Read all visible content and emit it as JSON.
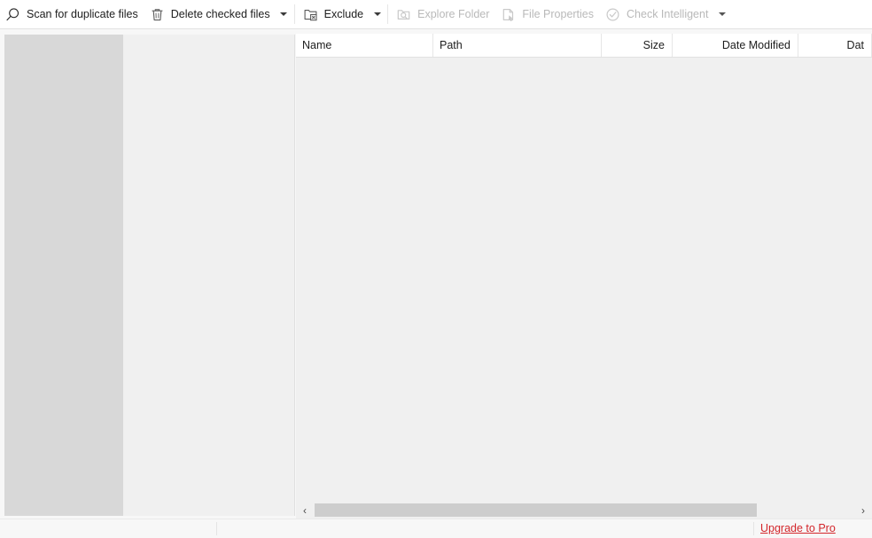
{
  "toolbar": {
    "items": [
      {
        "id": "scan",
        "label": "Scan for duplicate files",
        "icon": "magnifier-icon",
        "enabled": true,
        "caret": false
      },
      {
        "id": "delete",
        "label": "Delete checked files",
        "icon": "trash-icon",
        "enabled": true,
        "caret": true
      },
      {
        "id": "exclude",
        "label": "Exclude",
        "icon": "folder-exclude-icon",
        "enabled": true,
        "caret": true
      },
      {
        "id": "explore",
        "label": "Explore Folder",
        "icon": "folder-search-icon",
        "enabled": false,
        "caret": false
      },
      {
        "id": "properties",
        "label": "File Properties",
        "icon": "file-properties-icon",
        "enabled": false,
        "caret": false
      },
      {
        "id": "intelligent",
        "label": "Check Intelligent",
        "icon": "check-circle-icon",
        "enabled": false,
        "caret": true
      }
    ]
  },
  "file_list": {
    "columns": [
      {
        "label": "Name",
        "align": "left",
        "width": 155
      },
      {
        "label": "Path",
        "align": "left",
        "width": 190
      },
      {
        "label": "Size",
        "align": "right",
        "width": 80
      },
      {
        "label": "Date Modified",
        "align": "right",
        "width": 142
      },
      {
        "label": "Dat",
        "align": "right",
        "width": 83
      }
    ],
    "rows": []
  },
  "scrollbar": {
    "left_arrow": "‹",
    "right_arrow": "›"
  },
  "statusbar": {
    "upgrade_label": "Upgrade to Pro",
    "upgrade_color": "#d3262b"
  }
}
